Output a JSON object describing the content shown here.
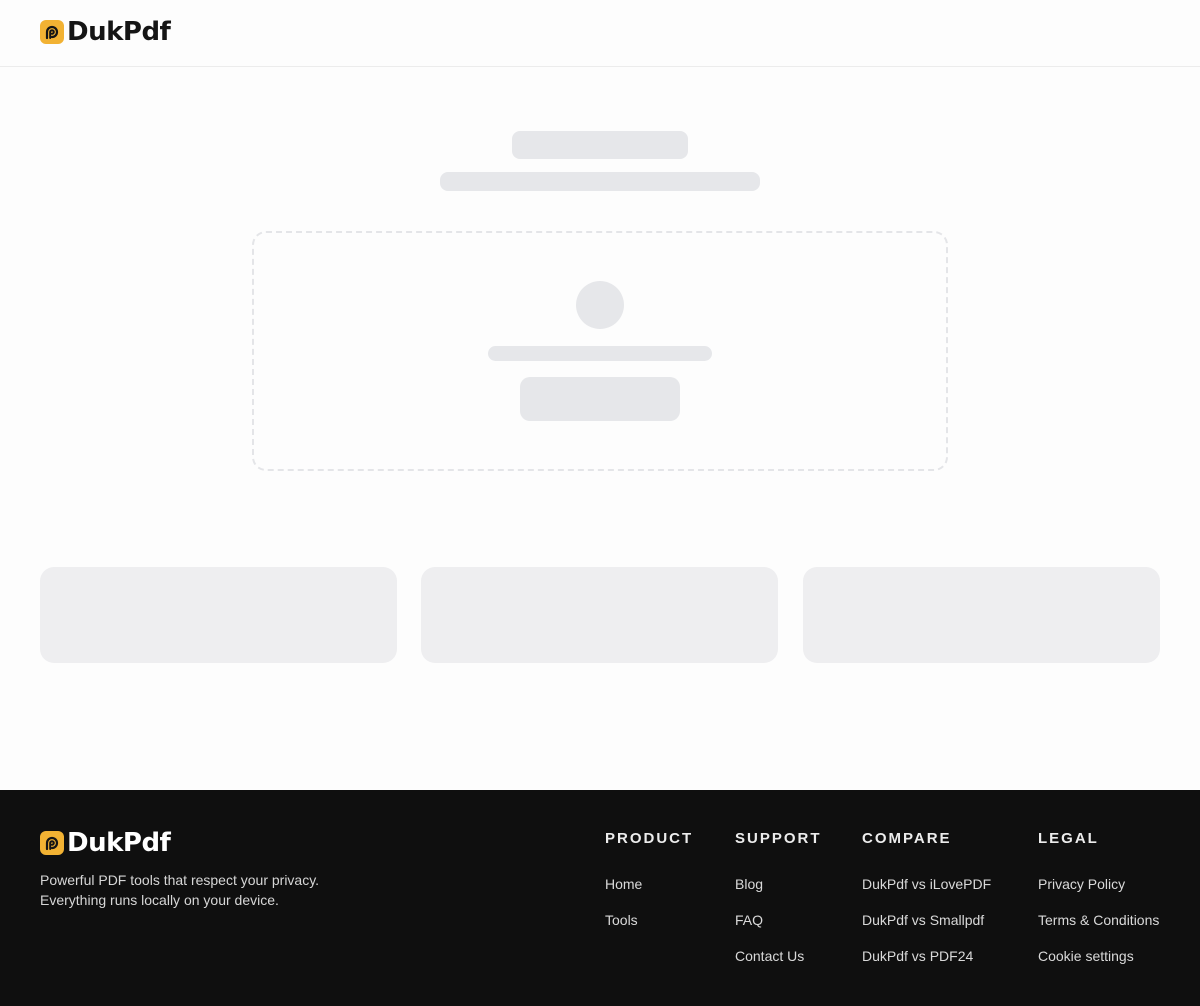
{
  "brand": {
    "name": "DukPdf",
    "accent_color": "#f2b233",
    "icon": "dukpdf-logo-icon"
  },
  "footer": {
    "tagline_lines": [
      "Powerful PDF tools that respect your privacy.",
      "Everything runs locally on your device."
    ],
    "columns": [
      {
        "heading": "PRODUCT",
        "links": [
          "Home",
          "Tools"
        ]
      },
      {
        "heading": "SUPPORT",
        "links": [
          "Blog",
          "FAQ",
          "Contact Us"
        ]
      },
      {
        "heading": "COMPARE",
        "links": [
          "DukPdf vs iLovePDF",
          "DukPdf vs Smallpdf",
          "DukPdf vs PDF24"
        ]
      },
      {
        "heading": "LEGAL",
        "links": [
          "Privacy Policy",
          "Terms & Conditions",
          "Cookie settings"
        ]
      }
    ]
  },
  "colors": {
    "skeleton": "#e6e7ea",
    "footer_bg": "#0f0f0f"
  }
}
